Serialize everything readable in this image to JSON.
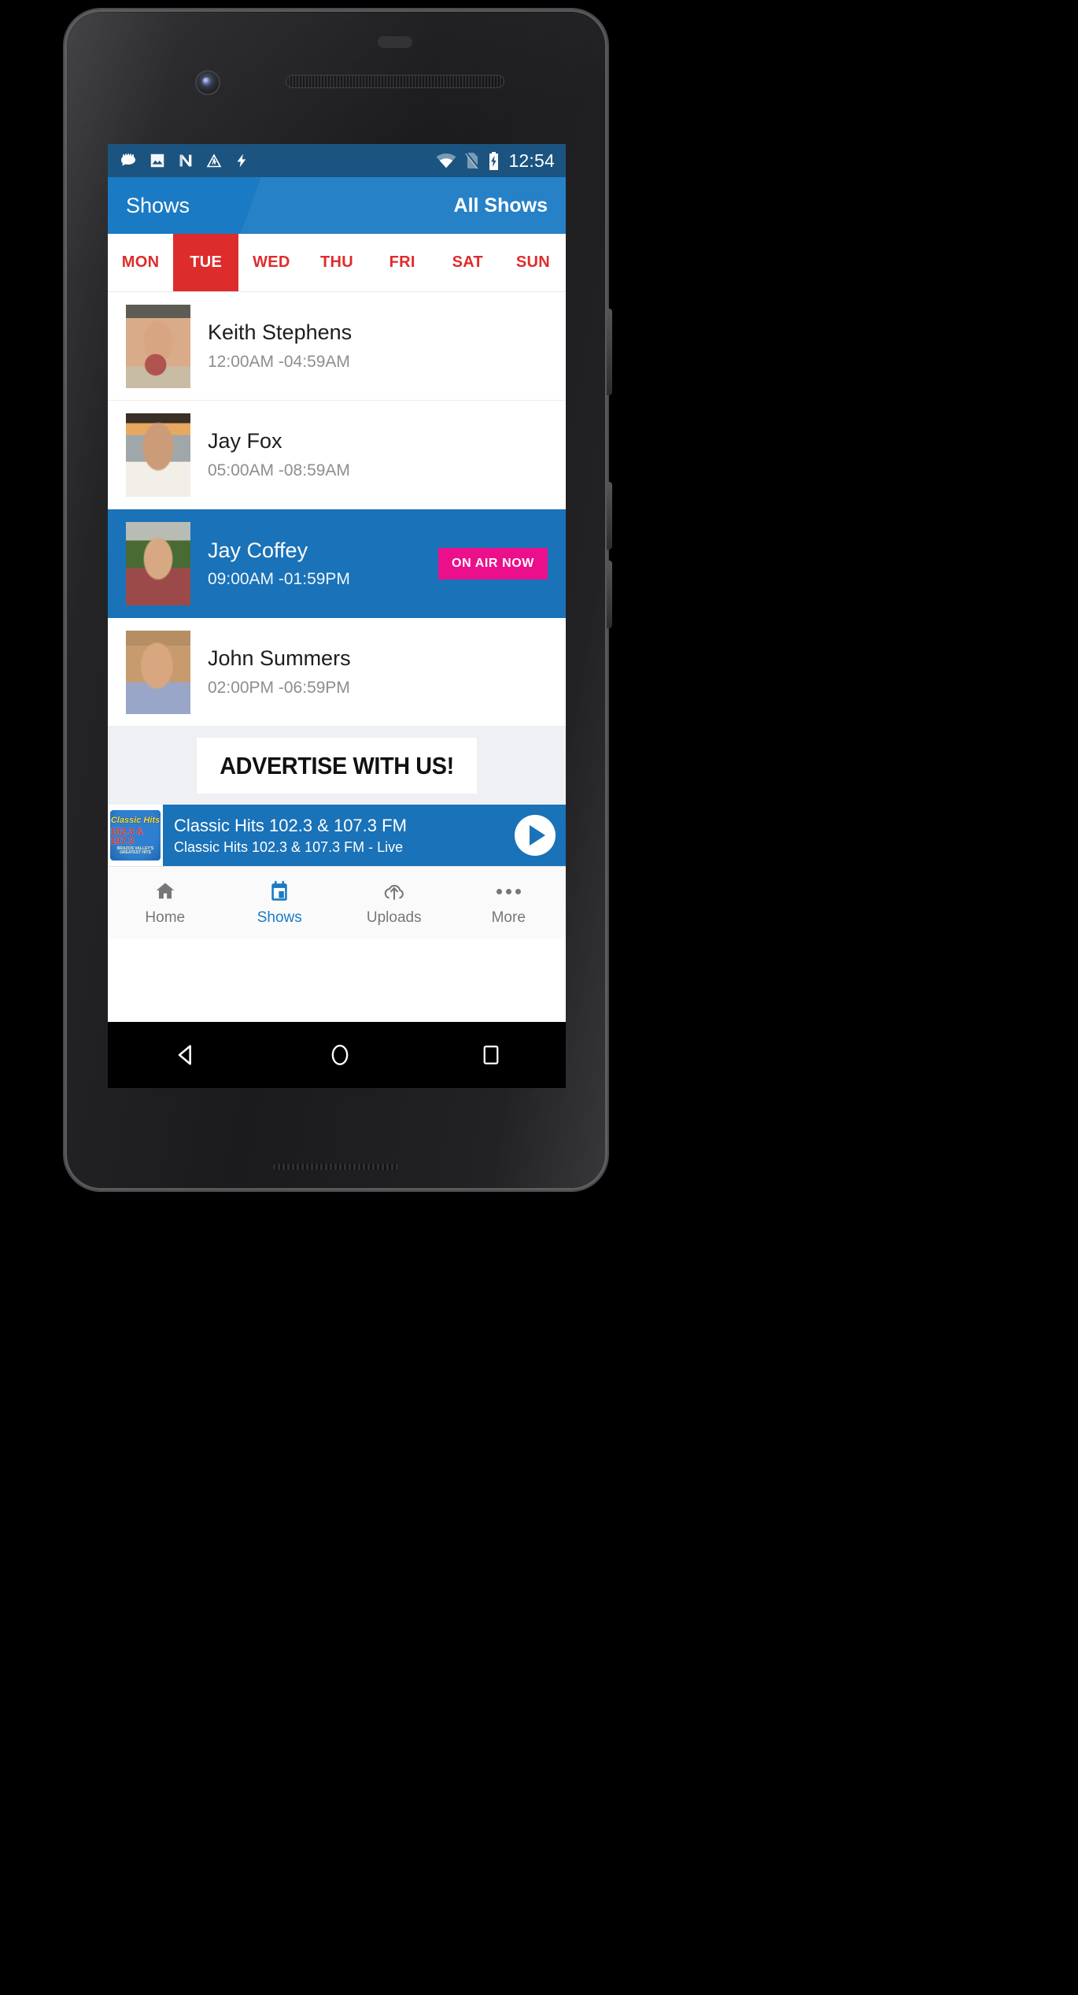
{
  "status_bar": {
    "left_icons": [
      "chat-bubble-icon",
      "image-icon",
      "nova-launcher-icon",
      "construction-warning-icon",
      "lightning-bolt-icon"
    ],
    "right_icons": [
      "wifi-icon",
      "no-sim-icon",
      "battery-charging-icon"
    ],
    "clock": "12:54"
  },
  "app_bar": {
    "title": "Shows",
    "action_label": "All Shows"
  },
  "day_tabs": [
    {
      "label": "MON",
      "active": false
    },
    {
      "label": "TUE",
      "active": true
    },
    {
      "label": "WED",
      "active": false
    },
    {
      "label": "THU",
      "active": false
    },
    {
      "label": "FRI",
      "active": false
    },
    {
      "label": "SAT",
      "active": false
    },
    {
      "label": "SUN",
      "active": false
    }
  ],
  "shows": [
    {
      "name": "Keith Stephens",
      "time": "12:00AM -04:59AM",
      "on_air": false,
      "badge": ""
    },
    {
      "name": "Jay Fox",
      "time": "05:00AM -08:59AM",
      "on_air": false,
      "badge": ""
    },
    {
      "name": "Jay Coffey",
      "time": "09:00AM -01:59PM",
      "on_air": true,
      "badge": "ON AIR NOW"
    },
    {
      "name": "John Summers",
      "time": "02:00PM -06:59PM",
      "on_air": false,
      "badge": ""
    }
  ],
  "advertisement": {
    "text": "ADVERTISE WITH US!"
  },
  "player": {
    "station_logo": {
      "line1": "Classic Hits",
      "line2": "102.3 & 107.3",
      "line3": "BRAZOS VALLEY'S GREATEST HITS"
    },
    "title": "Classic Hits 102.3 & 107.3 FM",
    "subtitle": "Classic Hits 102.3 & 107.3 FM - Live",
    "play_icon": "play-icon"
  },
  "bottom_nav": [
    {
      "label": "Home",
      "icon": "home-icon",
      "active": false
    },
    {
      "label": "Shows",
      "icon": "calendar-icon",
      "active": true
    },
    {
      "label": "Uploads",
      "icon": "cloud-upload-icon",
      "active": false
    },
    {
      "label": "More",
      "icon": "more-dots-icon",
      "active": false
    }
  ],
  "android_nav": [
    "back-icon",
    "home-circle-icon",
    "recents-square-icon"
  ],
  "colors": {
    "status_bar": "#1b5480",
    "app_bar": "#1a7ac4",
    "accent_red": "#dd2c2c",
    "on_air_row": "#1a72b8",
    "on_air_badge": "#ec0f8c",
    "nav_active": "#1a7ac4"
  }
}
